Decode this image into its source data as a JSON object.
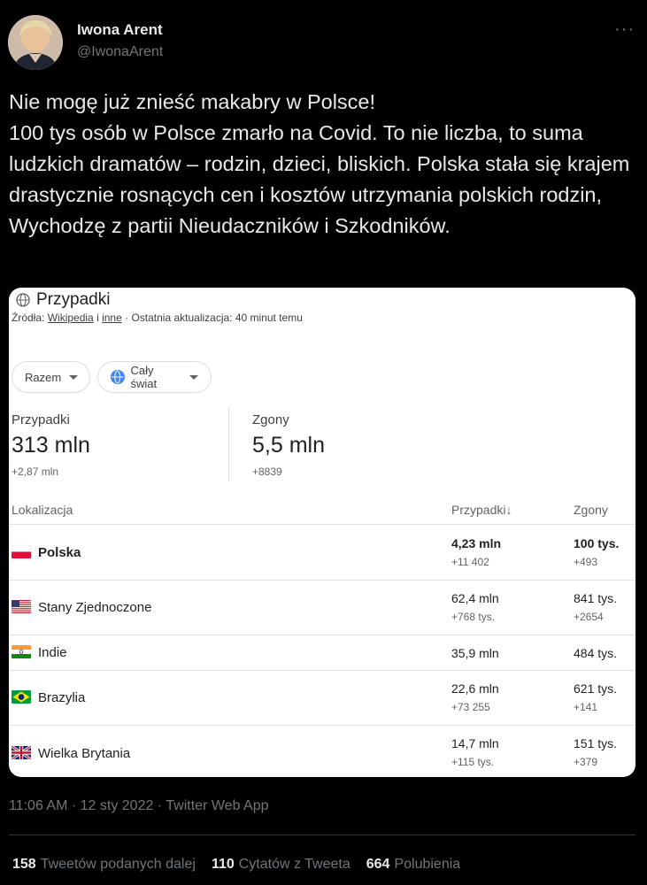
{
  "author": {
    "name": "Iwona Arent",
    "handle": "@IwonaArent"
  },
  "tweet": {
    "text": "Nie mogę już znieść makabry w Polsce!\n100 tys osób w Polsce zmarło na Covid. To nie liczba, to suma ludzkich dramatów – rodzin, dzieci, bliskich. Polska stała się krajem drastycznie rosnących cen i kosztów utrzymania polskich rodzin, Wychodzę z partii Nieudaczników i Szkodników.",
    "timestamp": "11:06 AM · 12 sty 2022 · Twitter Web App"
  },
  "card": {
    "title": "Przypadki",
    "sources_prefix": "Źródła:",
    "source_wikipedia": "Wikipedia",
    "source_and": "i",
    "source_other": "inne",
    "updated": "· Ostatnia aktualizacja: 40 minut temu",
    "filter_total": "Razem",
    "filter_world": "Cały świat",
    "summary": {
      "cases_label": "Przypadki",
      "cases_value": "313 mln",
      "cases_delta": "+2,87 mln",
      "deaths_label": "Zgony",
      "deaths_value": "5,5 mln",
      "deaths_delta": "+8839"
    },
    "table": {
      "col_location": "Lokalizacja",
      "col_cases": "Przypadki",
      "col_deaths": "Zgony",
      "rows": [
        {
          "country": "Polska",
          "cases": "4,23 mln",
          "cases_delta": "+11 402",
          "deaths": "100 tys.",
          "deaths_delta": "+493"
        },
        {
          "country": "Stany Zjednoczone",
          "cases": "62,4 mln",
          "cases_delta": "+768 tys.",
          "deaths": "841 tys.",
          "deaths_delta": "+2654"
        },
        {
          "country": "Indie",
          "cases": "35,9 mln",
          "cases_delta": "",
          "deaths": "484 tys.",
          "deaths_delta": ""
        },
        {
          "country": "Brazylia",
          "cases": "22,6 mln",
          "cases_delta": "+73 255",
          "deaths": "621 tys.",
          "deaths_delta": "+141"
        },
        {
          "country": "Wielka Brytania",
          "cases": "14,7 mln",
          "cases_delta": "+115 tys.",
          "deaths": "151 tys.",
          "deaths_delta": "+379"
        }
      ]
    }
  },
  "engagement": {
    "retweets_count": "158",
    "retweets_label": "Tweetów podanych dalej",
    "quotes_count": "110",
    "quotes_label": "Cytatów z Tweeta",
    "likes_count": "664",
    "likes_label": "Polubienia"
  },
  "icons": {
    "more": "more-icon",
    "globe": "globe-icon",
    "dropdown": "chevron-down-icon",
    "sort": "arrow-down-icon"
  },
  "colors": {
    "background": "#000000",
    "text": "#e7e9ea",
    "muted": "#71767b",
    "card": "#ffffff"
  }
}
